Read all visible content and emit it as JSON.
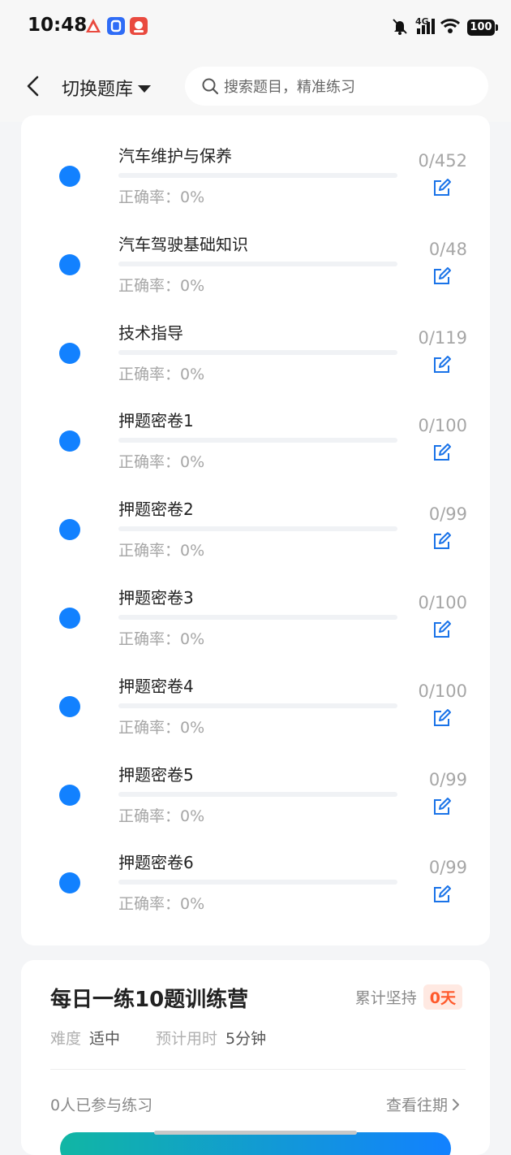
{
  "status_bar": {
    "time": "10:48",
    "network": "4G",
    "battery": "100"
  },
  "nav": {
    "title": "切换题库",
    "search_placeholder": "搜索题目，精准练习"
  },
  "chapters": [
    {
      "title": "汽车维护与保养",
      "accuracy": "正确率：0%",
      "count": "0/452",
      "progress": 0
    },
    {
      "title": "汽车驾驶基础知识",
      "accuracy": "正确率：0%",
      "count": "0/48",
      "progress": 0
    },
    {
      "title": "技术指导",
      "accuracy": "正确率：0%",
      "count": "0/119",
      "progress": 0
    },
    {
      "title": "押题密卷1",
      "accuracy": "正确率：0%",
      "count": "0/100",
      "progress": 0
    },
    {
      "title": "押题密卷2",
      "accuracy": "正确率：0%",
      "count": "0/99",
      "progress": 0
    },
    {
      "title": "押题密卷3",
      "accuracy": "正确率：0%",
      "count": "0/100",
      "progress": 0
    },
    {
      "title": "押题密卷4",
      "accuracy": "正确率：0%",
      "count": "0/100",
      "progress": 0
    },
    {
      "title": "押题密卷5",
      "accuracy": "正确率：0%",
      "count": "0/99",
      "progress": 0
    },
    {
      "title": "押题密卷6",
      "accuracy": "正确率：0%",
      "count": "0/99",
      "progress": 0
    }
  ],
  "daily": {
    "title": "每日一练10题训练营",
    "streak_label": "累计坚持",
    "streak_value": "0天",
    "difficulty_label": "难度",
    "difficulty_value": "适中",
    "time_label": "预计用时",
    "time_value": "5分钟",
    "participants": "0人已参与练习",
    "past_link": "查看往期"
  },
  "colors": {
    "accent": "#1281ff",
    "streak": "#ff5a2c"
  }
}
